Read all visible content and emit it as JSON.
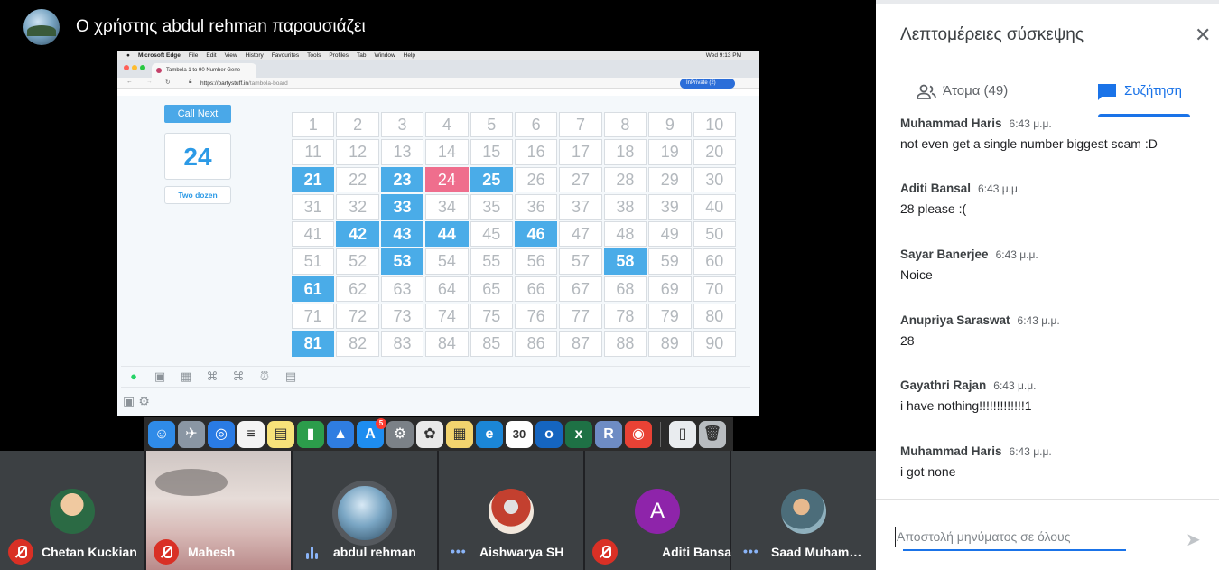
{
  "presenter": {
    "title": "Ο χρήστης abdul rehman παρουσιάζει"
  },
  "shared_screen": {
    "mac_menu": [
      "Microsoft Edge",
      "File",
      "Edit",
      "View",
      "History",
      "Favourites",
      "Tools",
      "Profiles",
      "Tab",
      "Window",
      "Help"
    ],
    "mac_status": "Wed 9:13 PM",
    "browser_tab": "Tambola 1 to 90 Number Gene",
    "url_host": "https://partystuff.in",
    "url_path": "/tambola-board",
    "inprivate": "InPrivate (2)",
    "call_next_label": "Call Next",
    "current_number": "24",
    "current_word": "Two dozen",
    "called_numbers": [
      21,
      23,
      25,
      33,
      42,
      43,
      44,
      46,
      53,
      58,
      61,
      81
    ],
    "latest_number": 24
  },
  "dock": {
    "icons": [
      "finder-icon",
      "launchpad-icon",
      "safari-icon",
      "reminders-icon",
      "notes-icon",
      "numbers-icon",
      "keynote-icon",
      "app-store-icon",
      "system-preferences-icon",
      "photos-icon",
      "stickies-icon",
      "edge-icon",
      "calendar-icon",
      "outlook-icon",
      "excel-icon",
      "r-icon",
      "chrome-icon",
      "document-icon",
      "trash-icon"
    ],
    "calendar_day": "30",
    "app_store_badge": "5"
  },
  "participants": [
    {
      "name": "Chetan Kuckian",
      "mic": "muted"
    },
    {
      "name": "Mahesh",
      "mic": "muted"
    },
    {
      "name": "abdul rehman",
      "mic": "speaking"
    },
    {
      "name": "Aishwarya SH",
      "mic": "active"
    },
    {
      "name": "Aditi Bansal",
      "mic": "muted",
      "initial": "A"
    },
    {
      "name": "Saad Muham…",
      "mic": "active"
    }
  ],
  "panel": {
    "title": "Λεπτομέρειες σύσκεψης",
    "tab_people": "Άτομα (49)",
    "tab_chat": "Συζήτηση",
    "messages": [
      {
        "sender": "Muhammad Haris",
        "time": "6:43 μ.μ.",
        "text": "not even get a single number biggest scam :D"
      },
      {
        "sender": "Aditi Bansal",
        "time": "6:43 μ.μ.",
        "text": "28 please :("
      },
      {
        "sender": "Sayar Banerjee",
        "time": "6:43 μ.μ.",
        "text": "Noice"
      },
      {
        "sender": "Anupriya Saraswat",
        "time": "6:43 μ.μ.",
        "text": "28"
      },
      {
        "sender": "Gayathri Rajan",
        "time": "6:43 μ.μ.",
        "text": "i have nothing!!!!!!!!!!!!!1"
      },
      {
        "sender": "Muhammad Haris",
        "time": "6:43 μ.μ.",
        "text": "i got none"
      }
    ],
    "composer_placeholder": "Αποστολή μηνύματος σε όλους"
  },
  "colors": {
    "accent": "#1a73e8",
    "called": "#4aace8",
    "current": "#ef6e8d",
    "muted": "#d93025"
  }
}
